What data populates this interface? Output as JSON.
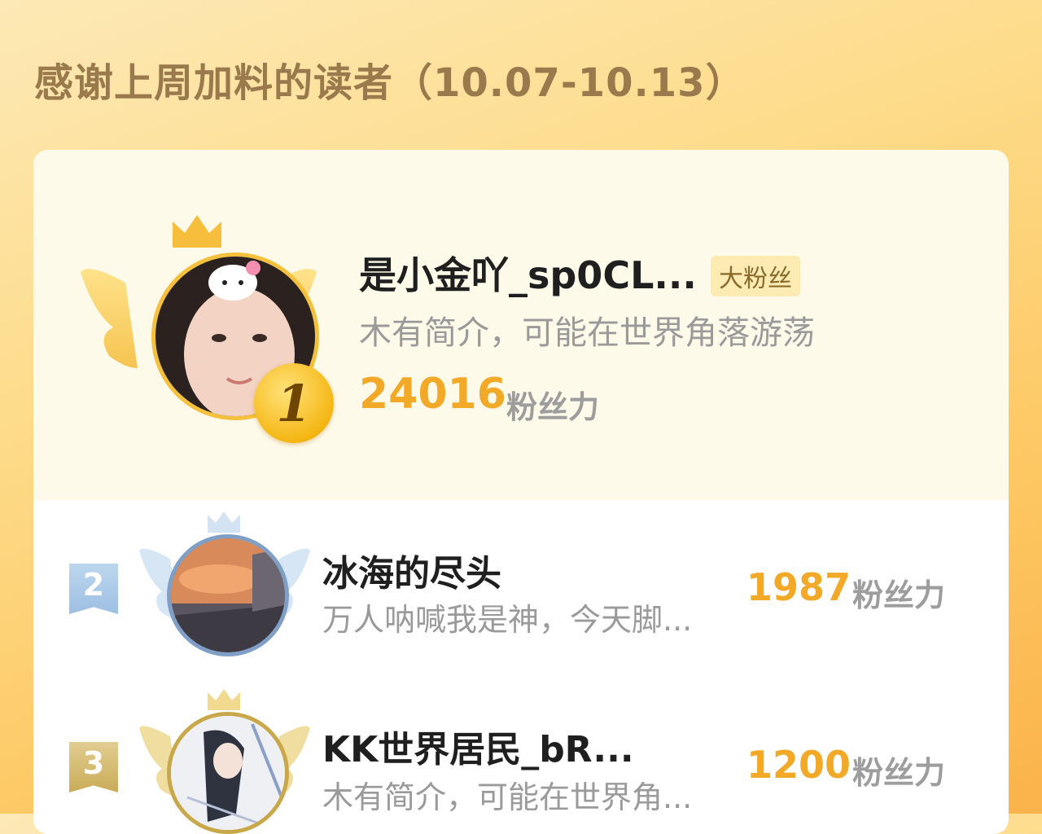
{
  "header": {
    "title": "感谢上周加料的读者（10.07-10.13）"
  },
  "first": {
    "rank": "1",
    "name": "是小金吖_sp0CL...",
    "badge": "大粉丝",
    "bio": "木有简介，可能在世界角落游荡",
    "score": "24016",
    "unit": "粉丝力"
  },
  "others": [
    {
      "rank": "2",
      "name": "冰海的尽头",
      "bio": "万人呐喊我是神，今天脚...",
      "score": "1987",
      "unit": "粉丝力"
    },
    {
      "rank": "3",
      "name": "KK世界居民_bR...",
      "bio": "木有简介，可能在世界角...",
      "score": "1200",
      "unit": "粉丝力"
    }
  ],
  "colors": {
    "gold": "#f3a928",
    "silver_flag": "#a9c8e8",
    "bronze_flag": "#d7bf7e",
    "title": "#9a7a4d"
  }
}
